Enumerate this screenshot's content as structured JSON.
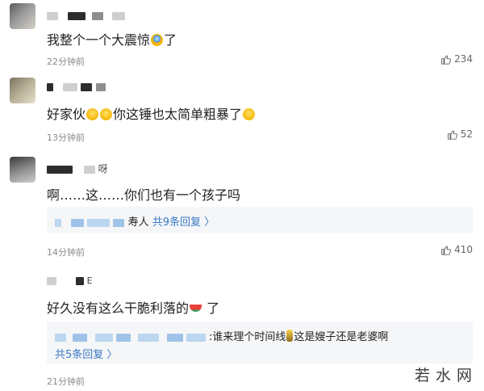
{
  "comments": [
    {
      "text": "我整个一个大震惊",
      "text_tail": "了",
      "time": "22分钟前",
      "likes": "234"
    },
    {
      "text": "好家伙",
      "text_mid": "你这锤也太简单粗暴了",
      "time": "13分钟前",
      "likes": "52"
    },
    {
      "name_suffix": "呀",
      "text": "啊……这……你们也有一个孩子吗",
      "reply_partial": "寿人",
      "reply_count": "共9条回复",
      "time": "14分钟前",
      "likes": "410"
    },
    {
      "name_suffix": "E",
      "text": "好久没有这么干脆利落的",
      "text_tail": " 了",
      "reply_text_a": ":谁来理个时间线",
      "reply_text_b": "这是嫂子还是老婆啊",
      "reply_count": "共5条回复",
      "time": "21分钟前"
    }
  ],
  "watermark": "若水网"
}
